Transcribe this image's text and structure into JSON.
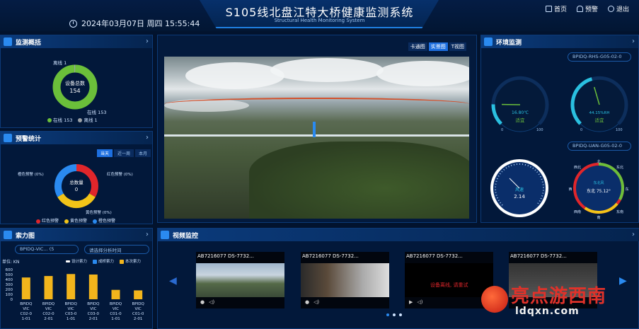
{
  "header": {
    "title": "S105线北盘江特大桥健康监测系统",
    "subtitle": "Structural Health Monitoring System",
    "datetime": "2024年03月07日 周四 15:55:44",
    "nav": [
      "首页",
      "预警",
      "退出"
    ]
  },
  "monitor_overview": {
    "title": "监测概括",
    "center_label": "设备总数",
    "total": "154",
    "offline_top": "离线 1",
    "online_side": "在线 153",
    "legend_online": "在线 153",
    "legend_offline": "离线 1",
    "online_color": "#6bbf3a",
    "offline_color": "#9aa0a6"
  },
  "alarm_stats": {
    "title": "预警统计",
    "tabs": [
      "当天",
      "近一周",
      "本月"
    ],
    "center_label": "总数量",
    "center_value": "0",
    "labels": {
      "orange": "橙色预警 (0%)",
      "red": "红色预警 (0%)",
      "yellow": "黄色预警 (0%)"
    },
    "legend": [
      "红色预警",
      "黄色预警",
      "橙色预警"
    ],
    "colors": {
      "red": "#e0262b",
      "yellow": "#f2c418",
      "blue": "#2a8af0"
    }
  },
  "cable_force": {
    "title": "索力图",
    "select1": "BPIDQ-VIC... (5",
    "select2": "请选择分析时间",
    "unit": "单位: KN",
    "legend": [
      "设计索力",
      "成桥索力",
      "本次索力"
    ],
    "colors": {
      "design": "#ffffff",
      "bridge": "#2a8af0",
      "current": "#f2b51c"
    },
    "chart_data": {
      "type": "bar",
      "categories": [
        "BPIDQ-VIC-C02-0-1-01",
        "BPIDQ-VIC-C02-0-2-01",
        "BPIDQ-VIC-C03-0-1-01",
        "BPIDQ-VIC-C03-0-2-01",
        "BPIDQ-VIC-C01-0-1-01",
        "BPIDQ-VIC-C01-0-2-01"
      ],
      "tick_labels": [
        "BPIDQ\nVIC\nC02-0\n1-01",
        "BPIDQ\nVIC\nC02-0\n2-01",
        "BPIDQ\nVIC\nC03-0\n1-01",
        "BPIDQ\nVIC\nC03-0\n2-01",
        "BPIDQ\nVIC\nC01-0\n1-01",
        "BPIDQ\nVIC\nC01-0\n2-01"
      ],
      "series": [
        {
          "name": "本次索力",
          "values": [
            440,
            470,
            510,
            500,
            190,
            180
          ]
        }
      ],
      "yticks": [
        "600",
        "500",
        "400",
        "300",
        "200",
        "100",
        "0"
      ],
      "ylim": [
        0,
        600
      ]
    }
  },
  "center_view": {
    "tabs": [
      "卡通图",
      "实景图",
      "T视图"
    ],
    "active_tab": 1
  },
  "environment": {
    "title": "环境监测",
    "select_top": "BPIDQ-RHS-G05-02-0",
    "select_bottom": "BPIDQ-UAN-G05-02-0",
    "temp": {
      "value": "16.80℃",
      "state": "适宜",
      "min": "0",
      "max": "100",
      "level": 0.17
    },
    "humidity": {
      "value": "44.15%RH",
      "state": "适宜",
      "min": "0",
      "max": "100",
      "level": 0.44
    },
    "wind": {
      "label": "风速",
      "value": "2.14"
    },
    "direction": {
      "label": "东北风",
      "value": "东北 75.12°",
      "n": "北",
      "s": "南",
      "e": "东",
      "w": "西",
      "ne": "东北",
      "nw": "西北",
      "se": "东南",
      "sw": "西南"
    }
  },
  "video": {
    "title": "视频监控",
    "cams": [
      {
        "label": "AB7216077 DS-7732...",
        "offline": ""
      },
      {
        "label": "AB7216077 DS-7732...",
        "offline": ""
      },
      {
        "label": "AB7216077 DS-7732...",
        "offline": "设备离线, 请重试"
      },
      {
        "label": "AB7216077 DS-7732...",
        "offline": ""
      }
    ]
  },
  "watermark": {
    "main": "亮点游西南",
    "sub": "ldqxn.com"
  }
}
